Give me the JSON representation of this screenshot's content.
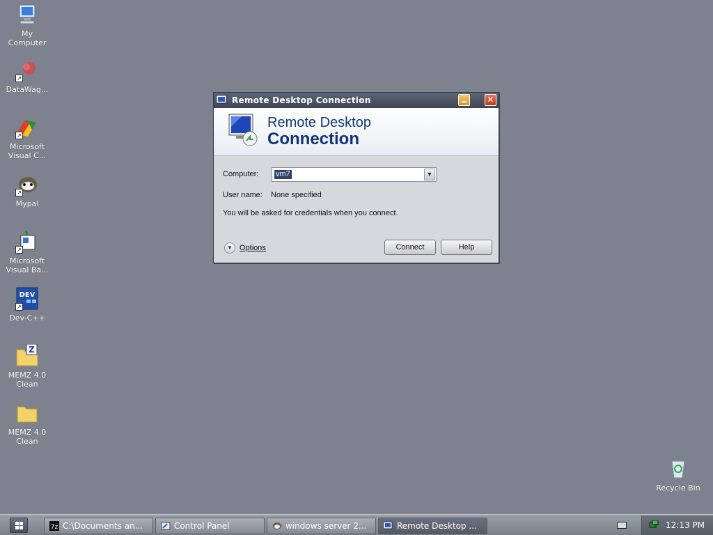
{
  "desktop": {
    "icons": [
      {
        "label": "My\nComputer"
      },
      {
        "label": "DataWag..."
      },
      {
        "label": "Microsoft\nVisual C..."
      },
      {
        "label": "Mypal"
      },
      {
        "label": "Microsoft\nVisual Ba..."
      },
      {
        "label": "Dev-C++"
      },
      {
        "label": "MEMZ 4.0\nClean"
      },
      {
        "label": "MEMZ 4.0\nClean"
      },
      {
        "label": "Recycle Bin"
      }
    ]
  },
  "dialog": {
    "title": "Remote Desktop Connection",
    "banner_line1": "Remote Desktop",
    "banner_line2": "Connection",
    "computer_label": "Computer:",
    "computer_value": "vm7",
    "username_label": "User name:",
    "username_value": "None specified",
    "note": "You will be asked for credentials when you connect.",
    "options_label": "Options",
    "connect_label": "Connect",
    "help_label": "Help",
    "dropdown_glyph": "▼",
    "close_glyph": "✕"
  },
  "taskbar": {
    "tasks": [
      {
        "label": "C:\\Documents an..."
      },
      {
        "label": "Control Panel"
      },
      {
        "label": "windows server 2..."
      },
      {
        "label": "Remote Desktop ..."
      }
    ],
    "clock": "12:13 PM"
  },
  "colors": {
    "desktop_bg": "#7d828e",
    "title_bar": "#4a5161",
    "banner_text": "#10357a"
  }
}
